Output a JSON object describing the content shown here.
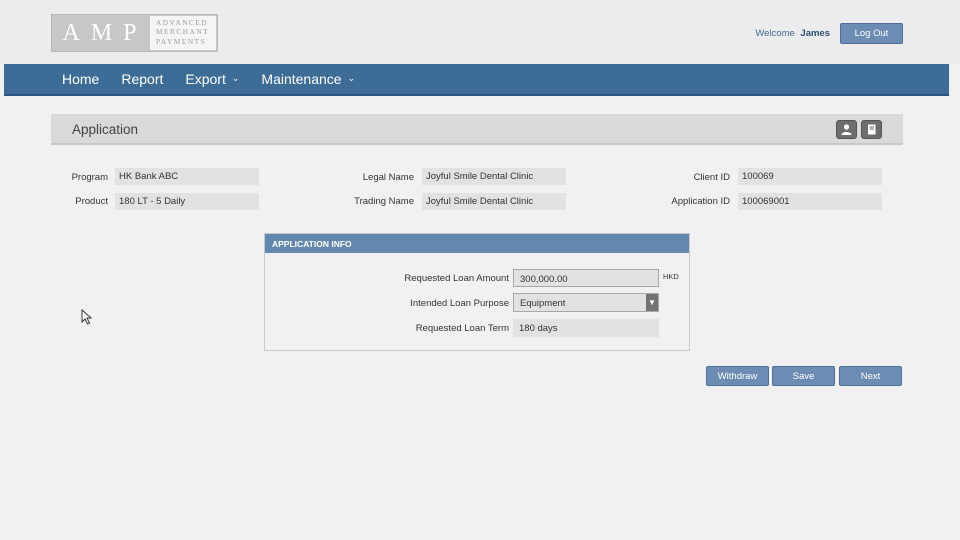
{
  "header": {
    "logo_letters": "AMP",
    "logo_lines": [
      "ADVANCED",
      "MERCHANT",
      "PAYMENTS"
    ],
    "welcome_prefix": "Welcome",
    "user_name": "James",
    "logout_label": "Log Out"
  },
  "nav": {
    "items": [
      {
        "label": "Home",
        "has_dropdown": false
      },
      {
        "label": "Report",
        "has_dropdown": false
      },
      {
        "label": "Export",
        "has_dropdown": true
      },
      {
        "label": "Maintenance",
        "has_dropdown": true
      }
    ]
  },
  "section": {
    "title": "Application",
    "icons": [
      "user-icon",
      "book-icon"
    ]
  },
  "fields": {
    "program": {
      "label": "Program",
      "value": "HK Bank ABC"
    },
    "product": {
      "label": "Product",
      "value": "180 LT - 5 Daily"
    },
    "legal_name": {
      "label": "Legal Name",
      "value": "Joyful Smile Dental Clinic"
    },
    "trading_name": {
      "label": "Trading Name",
      "value": "Joyful Smile Dental Clinic"
    },
    "client_id": {
      "label": "Client ID",
      "value": "100069"
    },
    "application_id": {
      "label": "Application ID",
      "value": "100069001"
    }
  },
  "app_info": {
    "heading": "APPLICATION INFO",
    "loan_amount": {
      "label": "Requested Loan Amount",
      "value": "300,000.00",
      "unit": "HKD"
    },
    "loan_purpose": {
      "label": "Intended Loan Purpose",
      "value": "Equipment"
    },
    "loan_term": {
      "label": "Requested Loan Term",
      "value": "180 days"
    }
  },
  "actions": {
    "withdraw": "Withdraw",
    "save": "Save",
    "next": "Next"
  },
  "colors": {
    "nav_bg": "#3d6c97",
    "button_bg": "#6c8cb4",
    "panel_head": "#6288ae"
  }
}
